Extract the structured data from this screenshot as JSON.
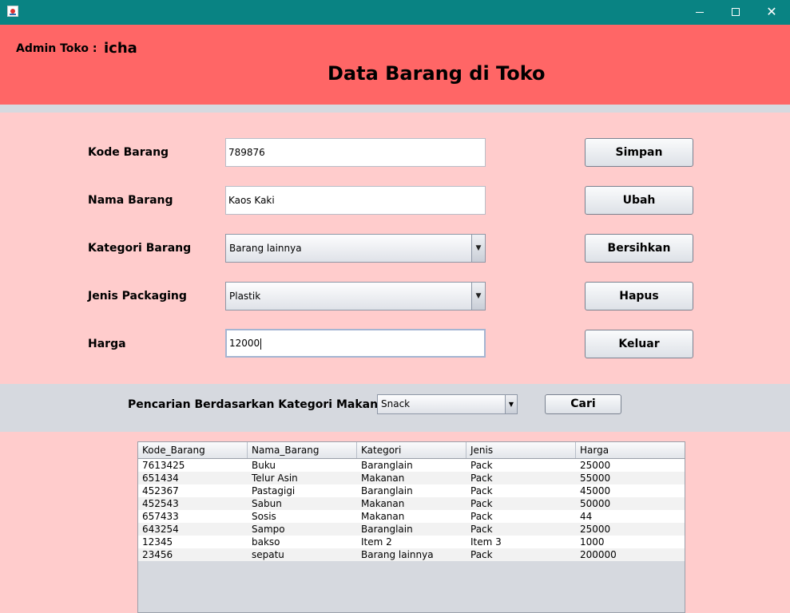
{
  "window": {
    "minimize_label": "",
    "maximize_label": "",
    "close_label": "✕"
  },
  "header": {
    "admin_label": "Admin Toko :",
    "admin_name": "icha",
    "title": "Data Barang di Toko"
  },
  "form": {
    "kode_label": "Kode Barang",
    "kode_value": "789876",
    "nama_label": "Nama Barang",
    "nama_value": "Kaos Kaki",
    "kategori_label": "Kategori Barang",
    "kategori_value": "Barang lainnya",
    "jenis_label": "Jenis Packaging",
    "jenis_value": "Plastik",
    "harga_label": "Harga",
    "harga_value": "12000"
  },
  "buttons": {
    "simpan": "Simpan",
    "ubah": "Ubah",
    "bersihkan": "Bersihkan",
    "hapus": "Hapus",
    "keluar": "Keluar"
  },
  "search": {
    "label": "Pencarian Berdasarkan Kategori Makanan",
    "selected": "Snack",
    "button": "Cari"
  },
  "table": {
    "headers": [
      "Kode_Barang",
      "Nama_Barang",
      "Kategori",
      "Jenis",
      "Harga"
    ],
    "rows": [
      [
        "7613425",
        "Buku",
        "Baranglain",
        "Pack",
        "25000"
      ],
      [
        "651434",
        "Telur Asin",
        "Makanan",
        "Pack",
        "55000"
      ],
      [
        "452367",
        "Pastagigi",
        "Baranglain",
        "Pack",
        "45000"
      ],
      [
        "452543",
        "Sabun",
        "Makanan",
        "Pack",
        "50000"
      ],
      [
        "657433",
        "Sosis",
        "Makanan",
        "Pack",
        "44"
      ],
      [
        "643254",
        "Sampo",
        "Baranglain",
        "Pack",
        "25000"
      ],
      [
        "12345",
        "bakso",
        "Item 2",
        "Item 3",
        "1000"
      ],
      [
        "23456",
        "sepatu",
        "Barang lainnya",
        "Pack",
        "200000"
      ]
    ]
  },
  "colors": {
    "titlebar": "#098383",
    "header": "#ff6666",
    "form_bg": "#ffcccc",
    "panel_gray": "#d6d9df"
  },
  "icons": {
    "app": "java-cup-icon",
    "combo_arrow": "▼"
  }
}
